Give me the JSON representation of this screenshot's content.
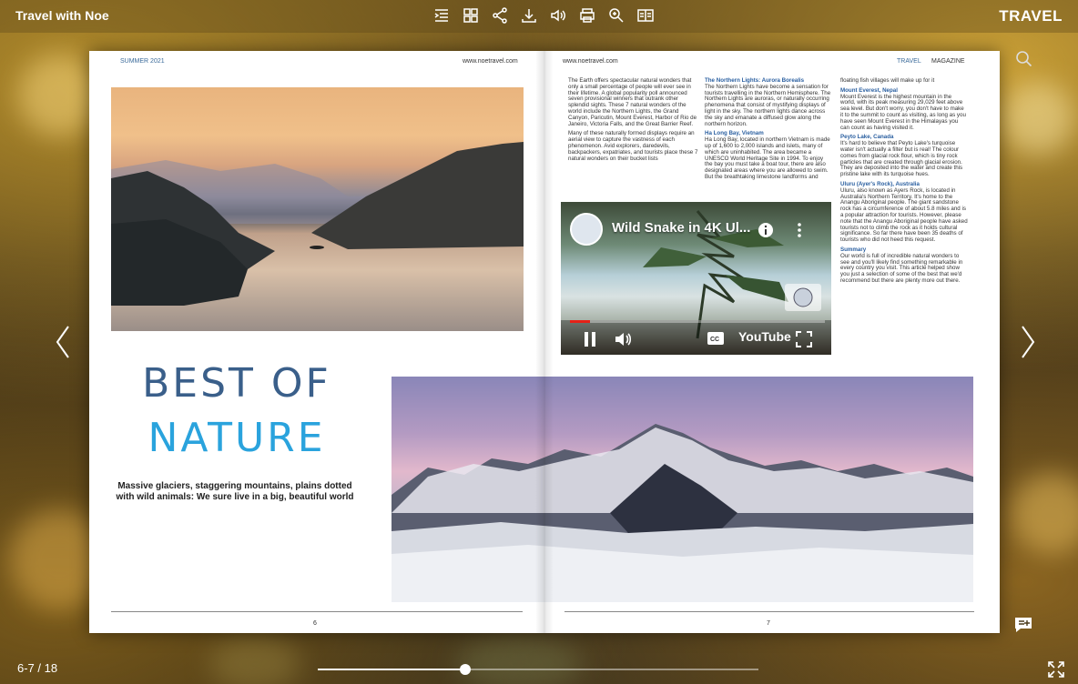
{
  "app": {
    "title": "Travel with Noe",
    "brand": "TRAVEL"
  },
  "toolbar": {
    "icons": [
      "table-of-contents-icon",
      "thumbnails-icon",
      "share-icon",
      "download-icon",
      "sound-icon",
      "print-icon",
      "zoom-icon",
      "text-view-icon"
    ]
  },
  "left_page": {
    "header_left": "SUMMER 2021",
    "header_right": "www.noetravel.com",
    "headline_line1": "BEST OF",
    "headline_line2": "NATURE",
    "subhead": "Massive glaciers, staggering mountains, plains dotted with wild animals: We sure live in a big, beautiful world",
    "page_number": "6"
  },
  "right_page": {
    "header_left": "www.noetravel.com",
    "header_right_1": "TRAVEL",
    "header_right_2": "MAGAZINE",
    "page_number": "7",
    "col1_p1": "The Earth offers spectacular natural wonders that only a small percentage of people will ever see in their lifetime. A global popularity poll announced seven provisional winners that outrank other splendid sights. These 7 natural wonders of the world include the Northern Lights, the Grand Canyon, Paricutin, Mount Everest, Harbor of Rio de Janeiro, Victoria Falls, and the Great Barrier Reef.",
    "col1_p2": "Many of these naturally formed displays require an aerial view to capture the vastness of each phenomenon. Avid explorers, daredevils, backpackers, expatriates, and tourists place these 7 natural wonders on their bucket lists",
    "col2_h1": "The Northern Lights: Aurora Borealis",
    "col2_p1": "The Northern Lights have become a sensation for tourists travelling in the Northern Hemisphere. The Northern Lights are auroras, or naturally occurring phenomena that consist of mystifying displays of light in the sky. The northern lights dance across the sky and emanate a diffused glow along the northern horizon.",
    "col2_h2": "Ha Long Bay, Vietnam",
    "col2_p2": "Ha Long Bay, located in northern Vietnam is made up of 1,600 to 2,000 islands and islets, many of which are uninhabited. The area became a UNESCO World Heritage Site in 1994. To enjoy the bay you must take a boat tour, there are also designated areas where you are allowed to swim. But the breathtaking limestone landforms and",
    "col3_p0": "floating fish villages will make up for it",
    "col3_h1": "Mount Everest, Nepal",
    "col3_p1": "Mount Everest is the highest mountain in the world, with its peak measuring 29,029 feet above sea level. But don't worry, you don't have to make it to the summit to count as visiting, as long as you have seen Mount Everest in the Himalayas you can count as having visited it.",
    "col3_h2": "Peyto Lake, Canada",
    "col3_p2": "It's hard to believe that Peyto Lake's turquoise water isn't actually a filter but is real! The colour comes from glacial rock flour, which is tiny rock particles that are created through glacial erosion. They are deposited into the water and create this pristine lake with its turquoise hues.",
    "col3_h3": "Uluru (Ayer's Rock), Australia",
    "col3_p3": "Uluru, also known as Ayers Rock, is located in Australia's Northern Territory. It's home to the Anangu Aboriginal people. The giant sandstone rock has a circumference of about 5.8 miles and is a popular attraction for tourists. However, please note that the Anangu Aboriginal people have asked tourists not to climb the rock as it holds cultural significance. So far there have been 35 deaths of tourists who did not heed this request.",
    "col3_h4": "Summary",
    "col3_p4": "Our world is full of incredible natural wonders to see and you'll likely find something remarkable in every country you visit. This article helped show you just a selection of some of the best that we'd recommend but there are plenty more out there."
  },
  "video": {
    "title": "Wild Snake in 4K Ul...",
    "platform": "YouTube",
    "progress": 0.08
  },
  "footer": {
    "page_counter": "6-7 / 18",
    "scrubber_position": 0.335
  }
}
